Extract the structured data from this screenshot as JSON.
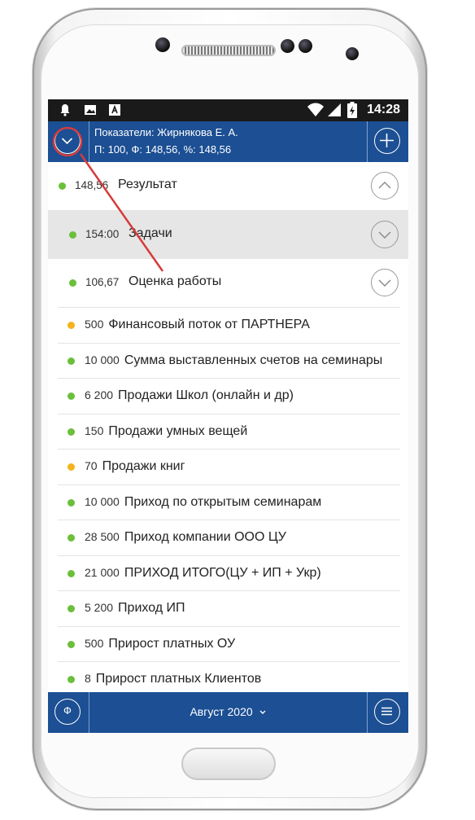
{
  "status_bar": {
    "time": "14:28"
  },
  "header": {
    "line1": "Показатели: Жирнякова Е. А.",
    "line2": "П: 100, Ф: 148,56, %: 148,56"
  },
  "main_rows": [
    {
      "value": "148,56",
      "label": "Результат",
      "dot_color": "#6bbf3a",
      "expand": "up"
    },
    {
      "value": "154:00",
      "label": "Задачи",
      "dot_color": "#6bbf3a",
      "expand": "down"
    },
    {
      "value": "106,67",
      "label": "Оценка работы",
      "dot_color": "#6bbf3a",
      "expand": "down"
    }
  ],
  "sub_rows": [
    {
      "value": "500",
      "label": "Финансовый поток от ПАРТНЕРА",
      "dot_color": "#f5b21c"
    },
    {
      "value": "10 000",
      "label": "Сумма выставленных счетов на семинары",
      "dot_color": "#6bbf3a"
    },
    {
      "value": "6 200",
      "label": "Продажи Школ (онлайн и др)",
      "dot_color": "#6bbf3a"
    },
    {
      "value": "150",
      "label": "Продажи умных вещей",
      "dot_color": "#6bbf3a"
    },
    {
      "value": "70",
      "label": "Продажи книг",
      "dot_color": "#f5b21c"
    },
    {
      "value": "10 000",
      "label": "Приход по открытым семинарам",
      "dot_color": "#6bbf3a"
    },
    {
      "value": "28 500",
      "label": "Приход компании ООО ЦУ",
      "dot_color": "#6bbf3a"
    },
    {
      "value": "21 000",
      "label": "ПРИХОД ИТОГО(ЦУ + ИП + Укр)",
      "dot_color": "#6bbf3a"
    },
    {
      "value": "5 200",
      "label": "Приход ИП",
      "dot_color": "#6bbf3a"
    },
    {
      "value": "500",
      "label": "Прирост платных ОУ",
      "dot_color": "#6bbf3a"
    },
    {
      "value": "8",
      "label": "Прирост платных Клиентов",
      "dot_color": "#6bbf3a"
    }
  ],
  "footer": {
    "left_button_glyph": "Ф",
    "month_label": "Август 2020"
  },
  "colors": {
    "brand_blue": "#1c4f93",
    "green": "#6bbf3a",
    "orange": "#f5b21c",
    "annotation_red": "#d63b3b"
  }
}
